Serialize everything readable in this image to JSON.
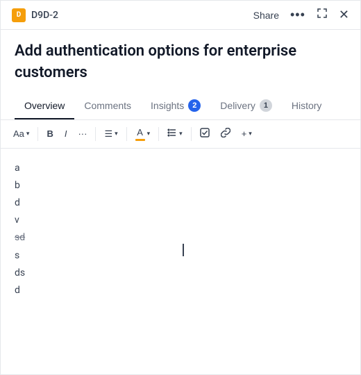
{
  "header": {
    "icon_label": "D",
    "ticket_id": "D9D-2",
    "share_label": "Share",
    "more_icon": "•••",
    "expand_icon": "⤢",
    "close_icon": "✕"
  },
  "title": {
    "text": "Add authentication options for enterprise customers"
  },
  "tabs": [
    {
      "label": "Overview",
      "active": true,
      "badge": null
    },
    {
      "label": "Comments",
      "active": false,
      "badge": null
    },
    {
      "label": "Insights",
      "active": false,
      "badge": "2",
      "badge_type": "blue"
    },
    {
      "label": "Delivery",
      "active": false,
      "badge": "1",
      "badge_type": "gray"
    },
    {
      "label": "History",
      "active": false,
      "badge": null
    }
  ],
  "toolbar": {
    "font_size_label": "Aa",
    "bold_label": "B",
    "italic_label": "I",
    "more_label": "···",
    "align_label": "≡",
    "color_label": "A",
    "list_label": "☰",
    "checkbox_label": "☑",
    "link_label": "🔗",
    "plus_label": "+"
  },
  "editor": {
    "lines": [
      {
        "text": "a",
        "strikethrough": false
      },
      {
        "text": "b",
        "strikethrough": false
      },
      {
        "text": "d",
        "strikethrough": false
      },
      {
        "text": "v",
        "strikethrough": false
      },
      {
        "text": "sd",
        "strikethrough": true
      },
      {
        "text": "s",
        "strikethrough": false
      },
      {
        "text": "ds",
        "strikethrough": false
      },
      {
        "text": "d",
        "strikethrough": false
      }
    ]
  }
}
